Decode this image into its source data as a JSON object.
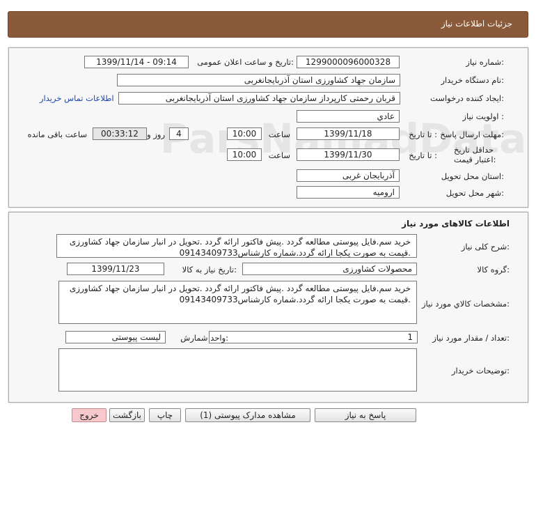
{
  "page": {
    "title": "جزئیات اطلاعات نیاز"
  },
  "info": {
    "need_no_label": "شماره نیاز:",
    "need_no": "1299000096000328",
    "announce_label": "تاریخ و ساعت اعلان عمومی:",
    "announce": "1399/11/14 - 09:14",
    "buyer_label": "نام دستگاه خریدار:",
    "buyer": "سازمان جهاد کشاورزی استان آذربایجانغربی",
    "creator_label": "ایجاد کننده درخواست:",
    "creator": "قربان  رحمتی  کارپرداز سازمان جهاد کشاورزی استان آذربایجانغربی",
    "contact_link": "اطلاعات تماس خریدار",
    "priority_label": "اولویت نیاز :",
    "priority": "عادي",
    "deadline_label": "مهلت ارسال پاسخ:",
    "until_date_label": "تا تاریخ :",
    "deadline_date": "1399/11/18",
    "time_label": "ساعت",
    "deadline_time": "10:00",
    "days": "4",
    "days_label": "روز و",
    "remaining": "00:33:12",
    "remaining_label": "ساعت باقی مانده",
    "validity_label": "حداقل تاریخ اعتبار قیمت:",
    "validity_until_label": "تا تاریخ :",
    "validity_date": "1399/11/30",
    "validity_time_label": "ساعت",
    "validity_time": "10:00",
    "province_label": "استان محل تحویل:",
    "province": "آذربایجان غربی",
    "city_label": "شهر محل تحویل:",
    "city": "ارومیه"
  },
  "goods": {
    "section_title": "اطلاعات کالاهای مورد نیاز",
    "desc_label": "شرح کلی نیاز:",
    "desc_line1": "خرید سم.فایل پیوستی مطالعه گردد .پیش فاکتور ارائه گردد .تحویل در انبار سازمان جهاد کشاورزی",
    "desc_line2": ".قیمت به صورت یکجا ارائه گردد.شماره کارشناس09143409733",
    "group_label": "گروه کالا:",
    "group": "محصولات کشاورزی",
    "need_date_label": "تاریخ نیاز به کالا:",
    "need_date": "1399/11/23",
    "spec_label": "مشخصات کالاي مورد نياز:",
    "spec_line1": "خرید سم.فایل پیوستی مطالعه گردد .پیش فاکتور ارائه گردد .تحویل در انبار سازمان جهاد کشاورزی",
    "spec_line2": ".قیمت به صورت یکجا ارائه گردد.شماره کارشناس09143409733",
    "qty_label": "تعداد / مقدار مورد نیاز:",
    "qty": "1",
    "unit_label": "واحد شمارش:",
    "unit": "لیست پیوستی",
    "buyer_notes_label": "توضیحات خریدار:",
    "buyer_notes": ""
  },
  "buttons": {
    "reply": "پاسخ به نیاز",
    "attachments": "مشاهده مدارک پیوستی (1)",
    "print": "چاپ",
    "back": "بازگشت",
    "exit": "خروج"
  },
  "watermark": {
    "brand": "ParsNamadData",
    "line1": "مرکز فراوری اطلاعات پارس نماد داده",
    "line2": "پایگاه اطلاع رسانی مناقصه و مزایده",
    "phone": "۰۲۱-۸۸۳۴۹۶۷۰-۵"
  }
}
